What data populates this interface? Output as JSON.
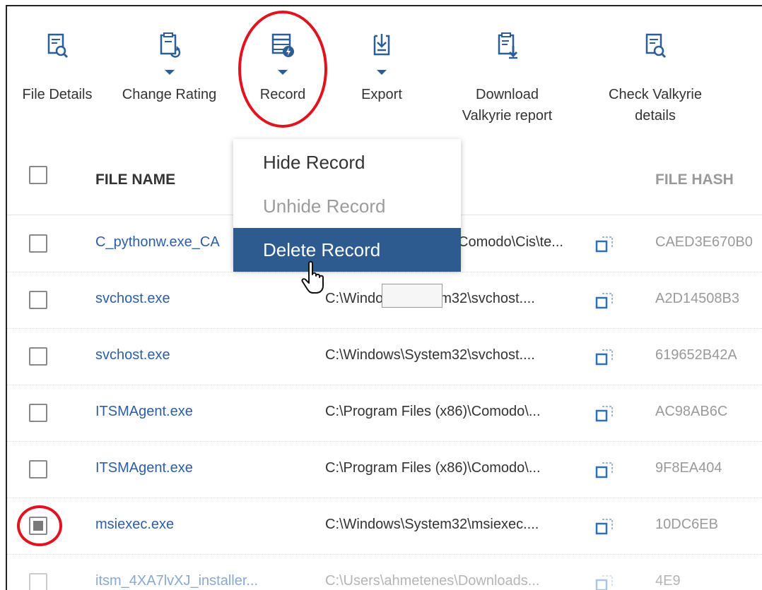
{
  "toolbar": {
    "file_details": "File Details",
    "change_rating": "Change Rating",
    "record": "Record",
    "export": "Export",
    "download_line1": "Download",
    "download_line2": "Valkyrie report",
    "check_line1": "Check Valkyrie",
    "check_line2": "details"
  },
  "table": {
    "col_file_name": "FILE NAME",
    "col_file_hash": "FILE HASH",
    "rows": [
      {
        "name": "C_pythonw.exe_CA",
        "path": "Comodo\\Cis\\te...",
        "hash": "CAED3E670B0"
      },
      {
        "name": "svchost.exe",
        "path": "C:\\Windows\\System32\\svchost....",
        "hash": "A2D14508B3"
      },
      {
        "name": "svchost.exe",
        "path": "C:\\Windows\\System32\\svchost....",
        "hash": "619652B42A"
      },
      {
        "name": "ITSMAgent.exe",
        "path": "C:\\Program Files (x86)\\Comodo\\...",
        "hash": "AC98AB6C"
      },
      {
        "name": "ITSMAgent.exe",
        "path": "C:\\Program Files (x86)\\Comodo\\...",
        "hash": "9F8EA404"
      },
      {
        "name": "msiexec.exe",
        "path": "C:\\Windows\\System32\\msiexec....",
        "hash": "10DC6EB"
      },
      {
        "name": "itsm_4XA7lvXJ_installer...",
        "path": "C:\\Users\\ahmetenes\\Downloads...",
        "hash": "4E9"
      }
    ]
  },
  "record_menu": {
    "hide": "Hide Record",
    "unhide": "Unhide Record",
    "delete": "Delete Record"
  },
  "colors": {
    "accent": "#2d5a8f",
    "link": "#2c5ea8",
    "highlight_circle": "#e0141e"
  }
}
